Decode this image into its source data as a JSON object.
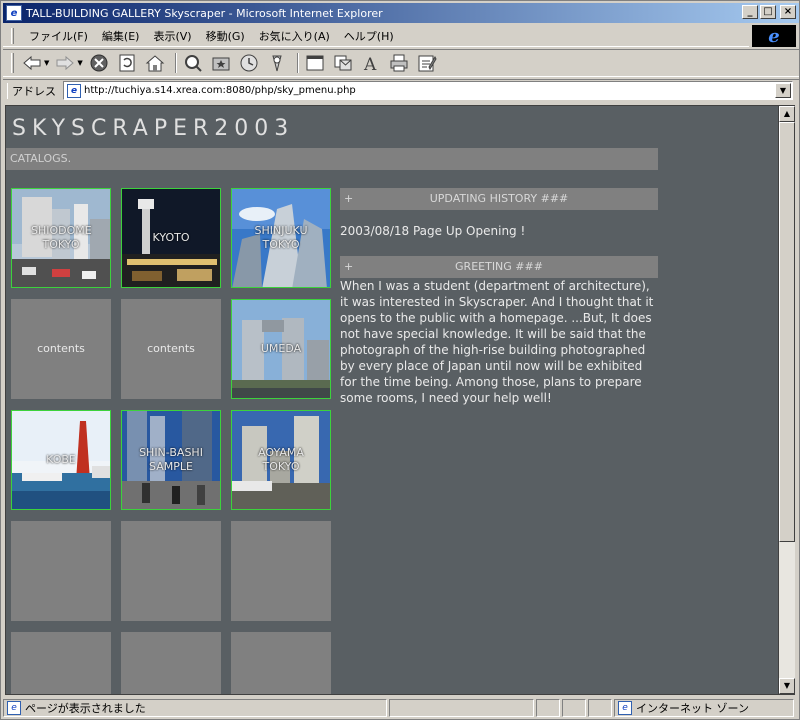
{
  "window": {
    "title": "TALL-BUILDING GALLERY Skyscraper - Microsoft Internet Explorer",
    "min_label": "_",
    "max_label": "□",
    "close_label": "×"
  },
  "menu": [
    "ファイル(F)",
    "編集(E)",
    "表示(V)",
    "移動(G)",
    "お気に入り(A)",
    "ヘルプ(H)"
  ],
  "address": {
    "label": "アドレス",
    "url": "http://tuchiya.s14.xrea.com:8080/php/sky_pmenu.php"
  },
  "page": {
    "site_title": "SKYSCRAPER2003",
    "catalog_label": "CATALOGS.",
    "thumbnails": [
      {
        "caption": "SHIODOME TOKYO",
        "kind": "photo"
      },
      {
        "caption": "KYOTO",
        "kind": "photo"
      },
      {
        "caption": "SHINJUKU TOKYO",
        "kind": "photo"
      },
      {
        "caption": "contents",
        "kind": "placeholder"
      },
      {
        "caption": "contents",
        "kind": "placeholder"
      },
      {
        "caption": "UMEDA",
        "kind": "photo"
      },
      {
        "caption": "KOBE",
        "kind": "photo"
      },
      {
        "caption": "SHIN-BASHI SAMPLE",
        "kind": "photo"
      },
      {
        "caption": "AOYAMA TOKYO",
        "kind": "photo"
      },
      {
        "caption": "",
        "kind": "placeholder"
      },
      {
        "caption": "",
        "kind": "placeholder"
      },
      {
        "caption": "",
        "kind": "placeholder"
      },
      {
        "caption": "",
        "kind": "placeholder"
      },
      {
        "caption": "",
        "kind": "placeholder"
      },
      {
        "caption": "",
        "kind": "placeholder"
      }
    ],
    "update_section": {
      "title": "UPDATING HISTORY ###",
      "plus": "+",
      "entry": "2003/08/18 Page Up Opening !"
    },
    "greeting_section": {
      "title": "GREETING ###",
      "plus": "+",
      "text": "When I was a student (department of architecture), it was interested in Skyscraper. And I thought that it opens to the public with a homepage. ...But, It does not have special knowledge. It will be said that the photograph of the high-rise building photographed by every place of Japan until now will be exhibited for the time being. Among those, plans to prepare some rooms, I need your help well!"
    }
  },
  "status": {
    "message": "ページが表示されました",
    "zone": "インターネット ゾーン"
  },
  "colors": {
    "page_bg": "#595f63",
    "bar_bg": "#808080",
    "thumb_border": "#3cd23c"
  }
}
